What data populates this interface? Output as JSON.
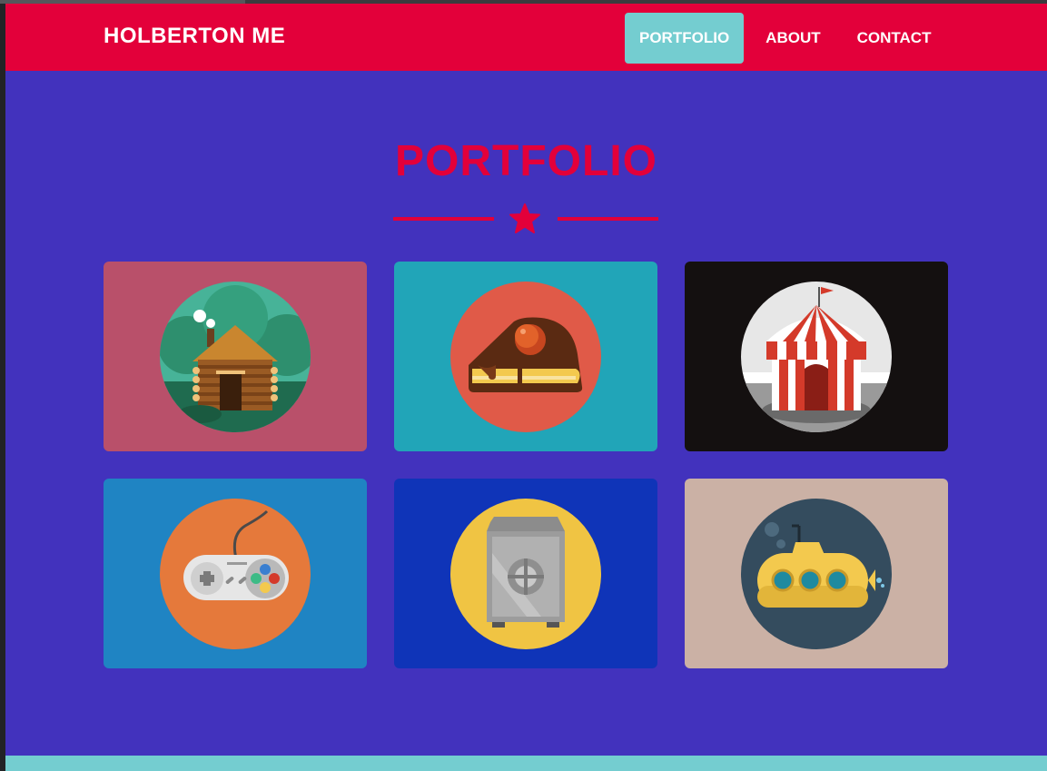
{
  "navbar": {
    "brand": "HOLBERTON ME",
    "links": [
      {
        "label": "PORTFOLIO",
        "active": true
      },
      {
        "label": "ABOUT",
        "active": false
      },
      {
        "label": "CONTACT",
        "active": false
      }
    ]
  },
  "portfolio": {
    "title": "PORTFOLIO",
    "divider_icon": "star-icon",
    "items": [
      {
        "icon": "log-cabin-icon",
        "background": "#b9506a"
      },
      {
        "icon": "cake-slice-icon",
        "background": "#21a5b8"
      },
      {
        "icon": "circus-tent-icon",
        "background": "#141010"
      },
      {
        "icon": "game-controller-icon",
        "background": "#1f84c3"
      },
      {
        "icon": "safe-icon",
        "background": "#0f34b8"
      },
      {
        "icon": "submarine-icon",
        "background": "#cbb1a5"
      }
    ]
  },
  "colors": {
    "accent": "#e3003a",
    "page_background": "#4232bd",
    "nav_active": "#74cdd0"
  }
}
